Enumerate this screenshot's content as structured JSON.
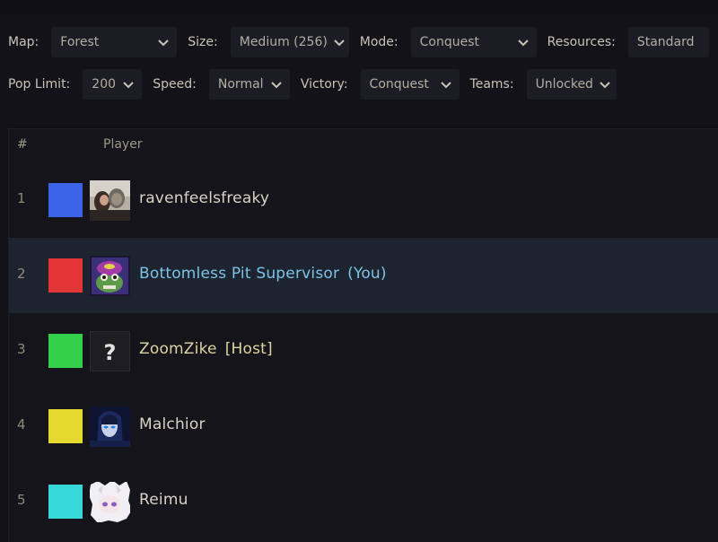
{
  "settings": {
    "map": {
      "label": "Map:",
      "value": "Forest"
    },
    "size": {
      "label": "Size:",
      "value": "Medium (256)"
    },
    "mode": {
      "label": "Mode:",
      "value": "Conquest"
    },
    "resources": {
      "label": "Resources:",
      "value": "Standard"
    },
    "pop_limit": {
      "label": "Pop Limit:",
      "value": "200"
    },
    "speed": {
      "label": "Speed:",
      "value": "Normal"
    },
    "victory": {
      "label": "Victory:",
      "value": "Conquest"
    },
    "teams": {
      "label": "Teams:",
      "value": "Unlocked"
    }
  },
  "table": {
    "header_num": "#",
    "header_player": "Player"
  },
  "players": [
    {
      "num": "1",
      "name": "ravenfeelsfreaky",
      "tag": "",
      "color": "#3a63e6"
    },
    {
      "num": "2",
      "name": "Bottomless Pit Supervisor",
      "tag": "(You)",
      "color": "#e33535"
    },
    {
      "num": "3",
      "name": "ZoomZike",
      "tag": "[Host]",
      "color": "#33d04b"
    },
    {
      "num": "4",
      "name": "Malchior",
      "tag": "",
      "color": "#e5d930"
    },
    {
      "num": "5",
      "name": "Reimu",
      "tag": "",
      "color": "#37d8d8"
    }
  ],
  "colors": {
    "background": "#121218",
    "selected_row": "#1d2430",
    "you_name": "#7cc3e6",
    "host_name": "#ded5a0"
  }
}
